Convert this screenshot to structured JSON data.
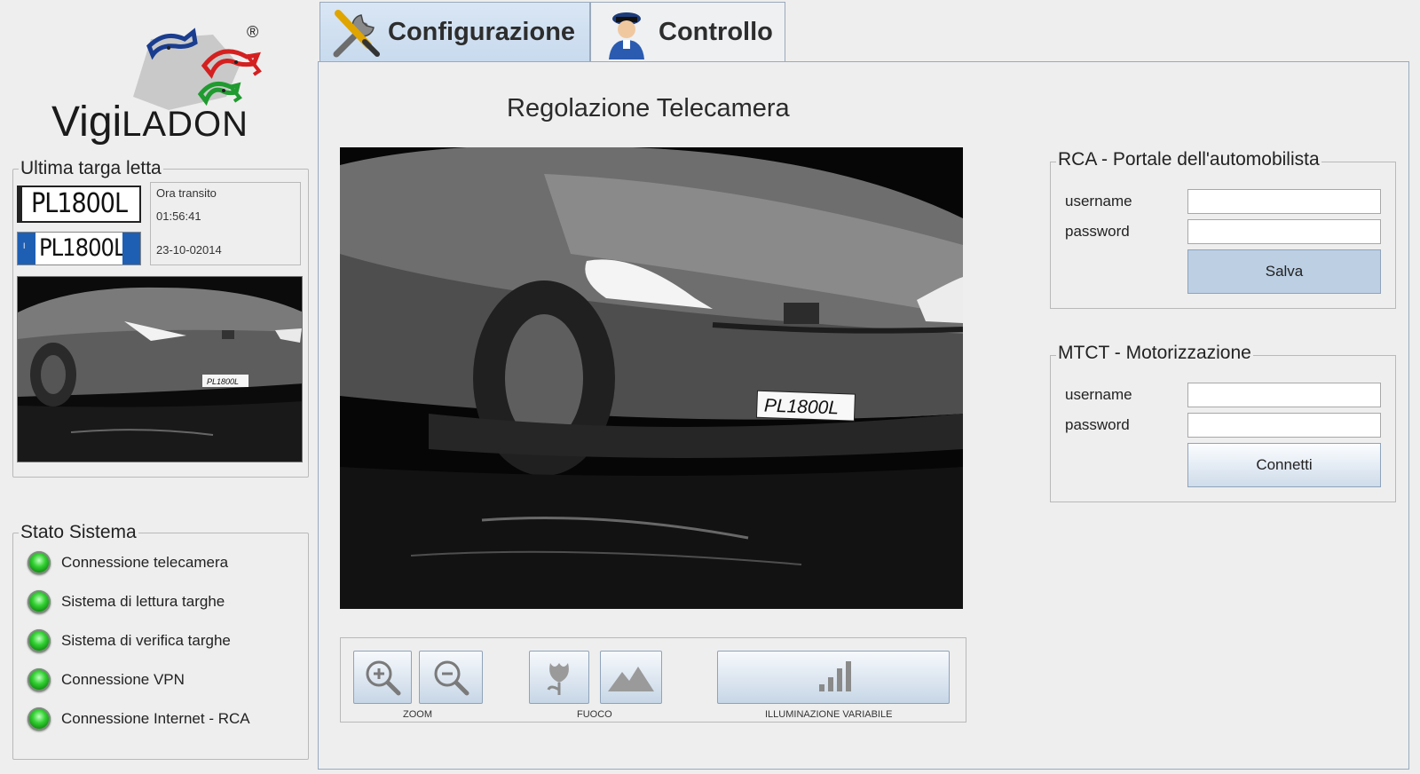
{
  "logo": {
    "brand_thin": "Vigi",
    "brand_bold": "LADON",
    "registered": "®"
  },
  "last_plate": {
    "legend": "Ultima targa letta",
    "plate_text": "PL1800L",
    "plate_text_eu": "PL1800L",
    "transit_label": "Ora transito",
    "transit_time": "01:56:41",
    "transit_date": "23-10-02014",
    "thumb_plate": "PL1800L"
  },
  "system_state": {
    "legend": "Stato Sistema",
    "items": [
      {
        "label": "Connessione telecamera",
        "status": "ok"
      },
      {
        "label": "Sistema di lettura targhe",
        "status": "ok"
      },
      {
        "label": "Sistema di verifica targhe",
        "status": "ok"
      },
      {
        "label": "Connessione VPN",
        "status": "ok"
      },
      {
        "label": "Connessione Internet - RCA",
        "status": "ok"
      }
    ]
  },
  "tabs": [
    {
      "label": "Configurazione",
      "icon": "tools-icon",
      "active": true
    },
    {
      "label": "Controllo",
      "icon": "police-officer-icon",
      "active": false
    }
  ],
  "camera": {
    "title": "Regolazione Telecamera",
    "plate_text": "PL1800L"
  },
  "controls": {
    "zoom_label": "ZOOM",
    "focus_label": "FUOCO",
    "illumination_label": "ILLUMINAZIONE VARIABILE"
  },
  "rca": {
    "legend": "RCA - Portale dell'automobilista",
    "username_label": "username",
    "password_label": "password",
    "username_value": "",
    "password_value": "",
    "button": "Salva"
  },
  "mtct": {
    "legend": "MTCT - Motorizzazione",
    "username_label": "username",
    "password_label": "password",
    "username_value": "",
    "password_value": "",
    "button": "Connetti"
  },
  "colors": {
    "led_ok": "#22c022",
    "active_tab": "#c8daee",
    "button_blue": "#bccfe3"
  }
}
